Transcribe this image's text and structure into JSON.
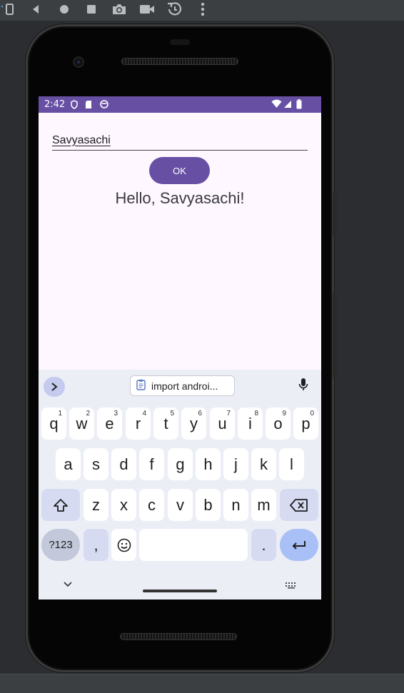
{
  "emulator_toolbar": {
    "items": [
      "rotate-icon",
      "back-icon",
      "home-icon",
      "overview-icon",
      "camera-icon",
      "video-icon",
      "snapshot-icon",
      "more-icon"
    ]
  },
  "status_bar": {
    "time": "2:42",
    "color": "#6750a4"
  },
  "app": {
    "name_input_value": "Savyasachi",
    "ok_label": "OK",
    "greeting": "Hello, Savyasachi!",
    "accent_color": "#6750a4"
  },
  "keyboard": {
    "suggestion": "import androi...",
    "row1": [
      {
        "key": "q",
        "hint": "1"
      },
      {
        "key": "w",
        "hint": "2"
      },
      {
        "key": "e",
        "hint": "3"
      },
      {
        "key": "r",
        "hint": "4"
      },
      {
        "key": "t",
        "hint": "5"
      },
      {
        "key": "y",
        "hint": "6"
      },
      {
        "key": "u",
        "hint": "7"
      },
      {
        "key": "i",
        "hint": "8"
      },
      {
        "key": "o",
        "hint": "9"
      },
      {
        "key": "p",
        "hint": "0"
      }
    ],
    "row2": [
      "a",
      "s",
      "d",
      "f",
      "g",
      "h",
      "j",
      "k",
      "l"
    ],
    "row3": [
      "z",
      "x",
      "c",
      "v",
      "b",
      "n",
      "m"
    ],
    "sym_label": "?123",
    "comma_label": ",",
    "period_label": "."
  }
}
